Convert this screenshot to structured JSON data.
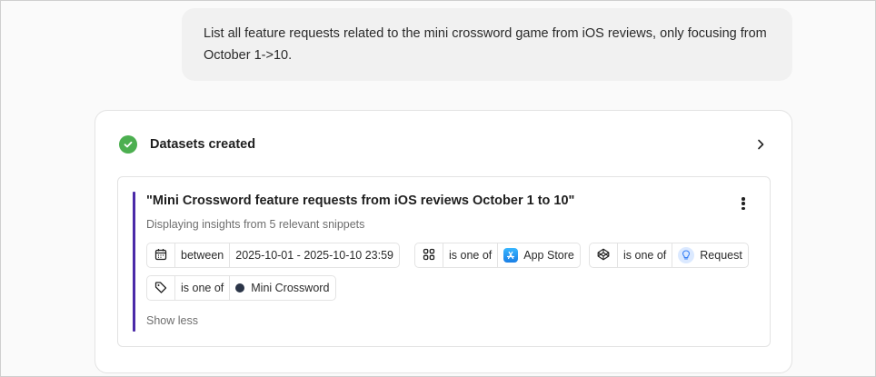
{
  "user_message": {
    "text": "List all feature requests related to the mini crossword game from iOS reviews, only focusing from October 1->10."
  },
  "result_card": {
    "header_title": "Datasets created",
    "status_icon": "check-circle-icon",
    "status_color": "#4caf50"
  },
  "dataset": {
    "title": "\"Mini Crossword feature requests from iOS reviews October 1 to 10\"",
    "subtitle": "Displaying insights from 5 relevant snippets",
    "accent_color": "#4b2aa8",
    "filters": [
      {
        "icon": "calendar-icon",
        "operator": "between",
        "value": "2025-10-01 - 2025-10-10 23:59"
      },
      {
        "icon": "grid-icon",
        "operator": "is one of",
        "value_icon": "app-store-icon",
        "value": "App Store"
      },
      {
        "icon": "codepen-icon",
        "operator": "is one of",
        "value_icon": "lightbulb-icon",
        "value": "Request"
      },
      {
        "icon": "tag-icon",
        "operator": "is one of",
        "value_icon": "dot-icon",
        "value": "Mini Crossword"
      }
    ],
    "show_less_label": "Show less"
  }
}
